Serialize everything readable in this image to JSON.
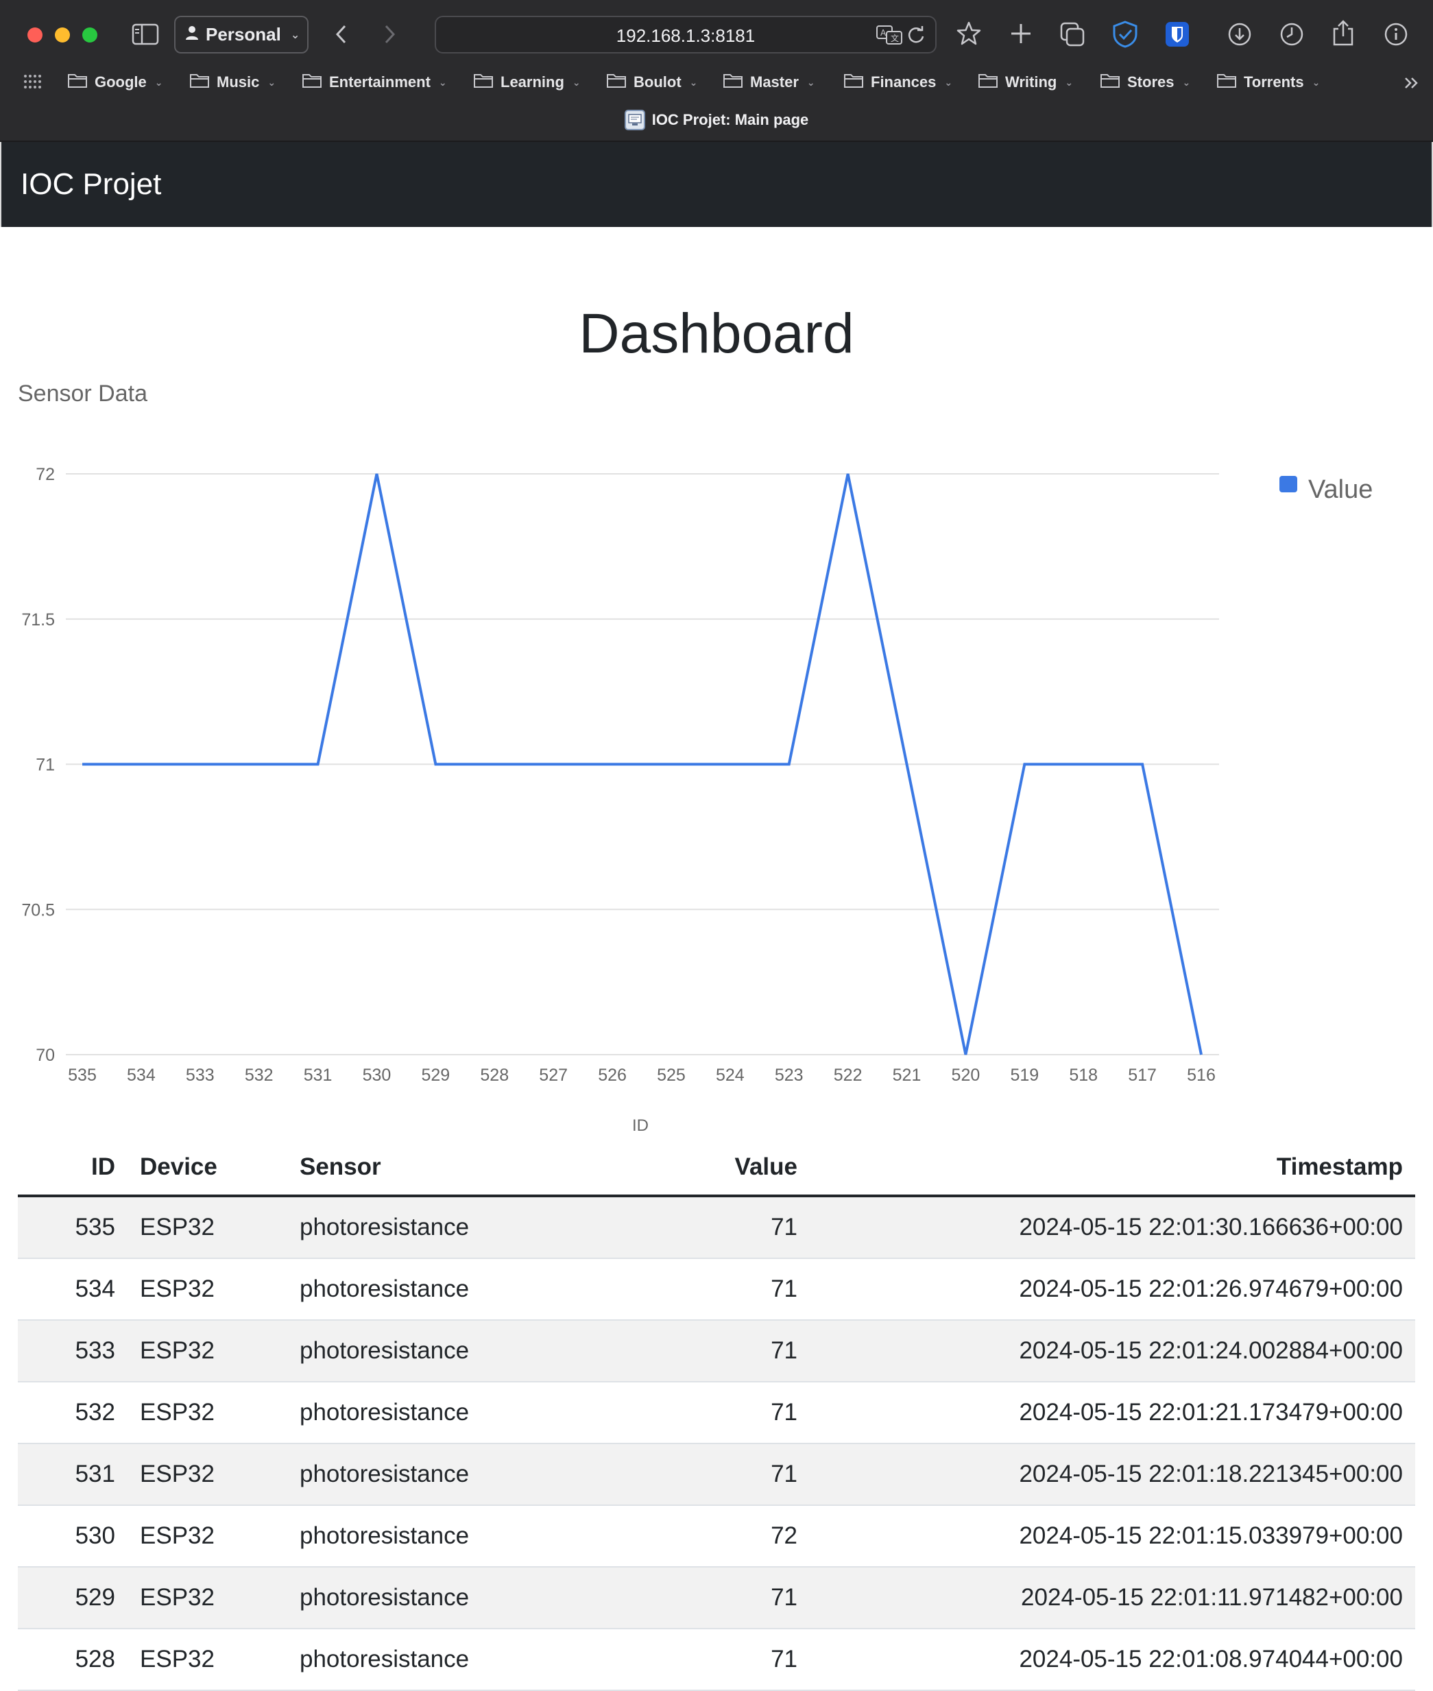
{
  "browser": {
    "profile_label": "Personal",
    "url": "192.168.1.3:8181",
    "tab_title": "IOC Projet: Main page",
    "bookmarks": [
      "Google",
      "Music",
      "Entertainment",
      "Learning",
      "Boulot",
      "Master",
      "Finances",
      "Writing",
      "Stores",
      "Torrents"
    ]
  },
  "navbar": {
    "brand": "IOC Projet"
  },
  "page": {
    "title": "Dashboard"
  },
  "chart_title": "Sensor Data",
  "chart_data": {
    "type": "line",
    "title": "Sensor Data",
    "xlabel": "ID",
    "ylabel": "",
    "categories": [
      "535",
      "534",
      "533",
      "532",
      "531",
      "530",
      "529",
      "528",
      "527",
      "526",
      "525",
      "524",
      "523",
      "522",
      "521",
      "520",
      "519",
      "518",
      "517",
      "516"
    ],
    "series": [
      {
        "name": "Value",
        "color": "#3b79e4",
        "values": [
          71,
          71,
          71,
          71,
          71,
          72,
          71,
          71,
          71,
          71,
          71,
          71,
          71,
          72,
          71,
          70,
          71,
          71,
          71,
          70
        ]
      }
    ],
    "ylim": [
      70,
      72
    ],
    "yticks": [
      "70",
      "70.5",
      "71",
      "71.5",
      "72"
    ],
    "grid": true,
    "legend": "top-right"
  },
  "table": {
    "headers": {
      "id": "ID",
      "device": "Device",
      "sensor": "Sensor",
      "value": "Value",
      "timestamp": "Timestamp"
    },
    "rows": [
      {
        "id": "535",
        "device": "ESP32",
        "sensor": "photoresistance",
        "value": "71",
        "timestamp": "2024-05-15 22:01:30.166636+00:00"
      },
      {
        "id": "534",
        "device": "ESP32",
        "sensor": "photoresistance",
        "value": "71",
        "timestamp": "2024-05-15 22:01:26.974679+00:00"
      },
      {
        "id": "533",
        "device": "ESP32",
        "sensor": "photoresistance",
        "value": "71",
        "timestamp": "2024-05-15 22:01:24.002884+00:00"
      },
      {
        "id": "532",
        "device": "ESP32",
        "sensor": "photoresistance",
        "value": "71",
        "timestamp": "2024-05-15 22:01:21.173479+00:00"
      },
      {
        "id": "531",
        "device": "ESP32",
        "sensor": "photoresistance",
        "value": "71",
        "timestamp": "2024-05-15 22:01:18.221345+00:00"
      },
      {
        "id": "530",
        "device": "ESP32",
        "sensor": "photoresistance",
        "value": "72",
        "timestamp": "2024-05-15 22:01:15.033979+00:00"
      },
      {
        "id": "529",
        "device": "ESP32",
        "sensor": "photoresistance",
        "value": "71",
        "timestamp": "2024-05-15 22:01:11.971482+00:00"
      },
      {
        "id": "528",
        "device": "ESP32",
        "sensor": "photoresistance",
        "value": "71",
        "timestamp": "2024-05-15 22:01:08.974044+00:00"
      }
    ]
  }
}
